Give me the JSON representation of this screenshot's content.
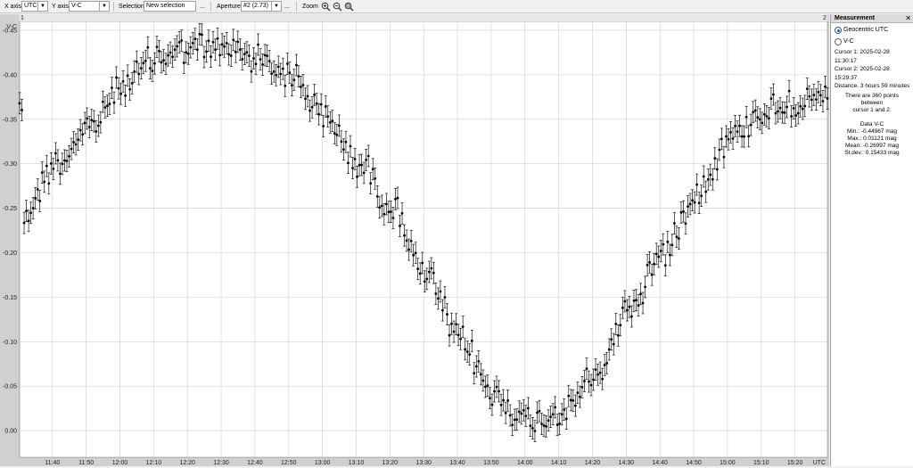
{
  "toolbar": {
    "xaxis_label": "X axis",
    "xaxis_value": "UTC",
    "yaxis_label": "Y axis",
    "yaxis_value": "V-C",
    "selection_label": "Selection",
    "selection_value": "New selection",
    "selection_more": "...",
    "aperture_label": "Aperture",
    "aperture_value": "#2 (2.73)",
    "aperture_more": "...",
    "zoom_label": "Zoom"
  },
  "panel": {
    "title": "Measurement",
    "close": "✕",
    "radio_geocentric": "Geocentric UTC",
    "radio_vc": "V-C",
    "cursor1": "Cursor 1: 2025-02-28 11:30:17",
    "cursor2": "Cursor 2: 2025-02-28 15:29:37",
    "distance": "Distance: 3 hours 59 minutes",
    "points_line1": "There are 360 points between",
    "points_line2": "cursor 1 and 2.",
    "data_title": "Data V-C",
    "min": "Min.: -0.44967 mag",
    "max": "Max.: 0.01121 mag",
    "mean": "Mean: -0.26997 mag",
    "stdev": "St.dev.: 0.15433 mag"
  },
  "chart_data": {
    "type": "scatter",
    "xlabel": "UTC",
    "ylabel": "V-C",
    "cursor_markers": [
      "1",
      "2"
    ],
    "x_range": [
      "11:30:17",
      "15:29:37"
    ],
    "ylim": [
      0.03,
      -0.46
    ],
    "y_inverted": true,
    "grid": true,
    "x_ticks": [
      "11:40",
      "11:50",
      "12:00",
      "12:10",
      "12:20",
      "12:30",
      "12:40",
      "12:50",
      "13:00",
      "13:10",
      "13:20",
      "13:30",
      "13:40",
      "13:50",
      "14:00",
      "14:10",
      "14:20",
      "14:30",
      "14:40",
      "14:50",
      "15:00",
      "15:10",
      "15:20"
    ],
    "x_axis_end_label": "UTC",
    "y_ticks": [
      "-0.45",
      "-0.40",
      "-0.35",
      "-0.30",
      "-0.25",
      "-0.20",
      "-0.15",
      "-0.10",
      "-0.05",
      "0.00"
    ],
    "n_points": 360,
    "error_bar": 0.012,
    "series": [
      {
        "x": [
          "11:31",
          "11:41",
          "11:51",
          "12:01",
          "12:11",
          "12:21",
          "12:31",
          "12:41",
          "12:51",
          "13:01",
          "13:11",
          "13:21",
          "13:31",
          "13:41",
          "13:51",
          "14:01",
          "14:11",
          "14:21",
          "14:31",
          "14:41",
          "14:51",
          "15:01",
          "15:11",
          "15:21",
          "15:29"
        ],
        "y": [
          -0.24,
          -0.3,
          -0.34,
          -0.39,
          -0.42,
          -0.43,
          -0.43,
          -0.42,
          -0.4,
          -0.35,
          -0.3,
          -0.25,
          -0.17,
          -0.1,
          -0.04,
          -0.01,
          -0.02,
          -0.06,
          -0.14,
          -0.2,
          -0.27,
          -0.33,
          -0.36,
          -0.37,
          -0.37
        ]
      }
    ]
  }
}
